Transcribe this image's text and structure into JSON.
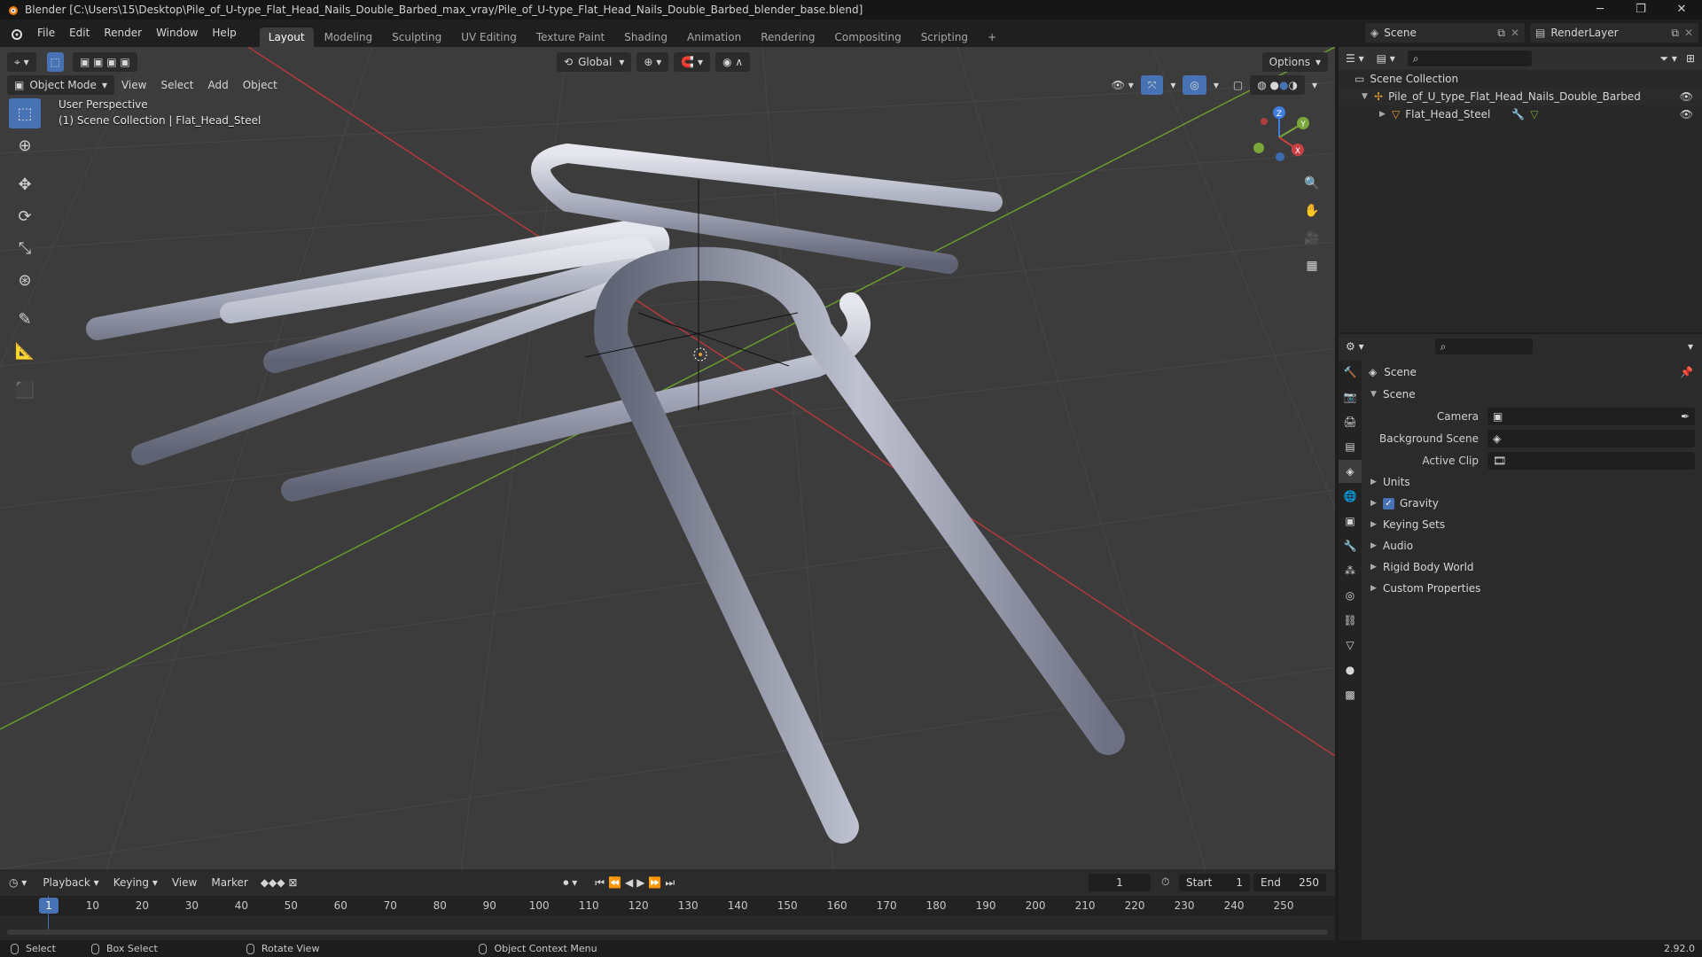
{
  "app": {
    "window_title": "Blender [C:\\Users\\15\\Desktop\\Pile_of_U-type_Flat_Head_Nails_Double_Barbed_max_vray/Pile_of_U-type_Flat_Head_Nails_Double_Barbed_blender_base.blend]",
    "version": "2.92.0"
  },
  "menu": [
    "File",
    "Edit",
    "Render",
    "Window",
    "Help"
  ],
  "workspaces": [
    {
      "label": "Layout",
      "active": true
    },
    {
      "label": "Modeling",
      "active": false
    },
    {
      "label": "Sculpting",
      "active": false
    },
    {
      "label": "UV Editing",
      "active": false
    },
    {
      "label": "Texture Paint",
      "active": false
    },
    {
      "label": "Shading",
      "active": false
    },
    {
      "label": "Animation",
      "active": false
    },
    {
      "label": "Rendering",
      "active": false
    },
    {
      "label": "Compositing",
      "active": false
    },
    {
      "label": "Scripting",
      "active": false
    }
  ],
  "scene_selector": "Scene",
  "render_layer": "RenderLayer",
  "viewport": {
    "mode": "Object Mode",
    "menus": [
      "View",
      "Select",
      "Add",
      "Object"
    ],
    "transform_orientation": "Global",
    "options_label": "Options",
    "info_line1": "User Perspective",
    "info_line2": "(1) Scene Collection | Flat_Head_Steel",
    "axis_labels": {
      "x": "X",
      "y": "Y",
      "z": "Z"
    }
  },
  "outliner": {
    "root": "Scene Collection",
    "items": [
      {
        "label": "Pile_of_U_type_Flat_Head_Nails_Double_Barbed",
        "indent": 1
      },
      {
        "label": "Flat_Head_Steel",
        "indent": 2
      }
    ]
  },
  "properties": {
    "context": "Scene",
    "panel_title": "Scene",
    "fields": [
      {
        "label": "Camera",
        "value": ""
      },
      {
        "label": "Background Scene",
        "value": ""
      },
      {
        "label": "Active Clip",
        "value": ""
      }
    ],
    "subpanels": [
      {
        "label": "Units",
        "checkbox": false
      },
      {
        "label": "Gravity",
        "checkbox": true
      },
      {
        "label": "Keying Sets",
        "checkbox": false
      },
      {
        "label": "Audio",
        "checkbox": false
      },
      {
        "label": "Rigid Body World",
        "checkbox": false
      },
      {
        "label": "Custom Properties",
        "checkbox": false
      }
    ]
  },
  "timeline": {
    "menus": [
      "Playback",
      "Keying",
      "View",
      "Marker"
    ],
    "current_frame": "1",
    "start_label": "Start",
    "start": "1",
    "end_label": "End",
    "end": "250",
    "ticks": [
      "1",
      "10",
      "20",
      "30",
      "40",
      "50",
      "60",
      "70",
      "80",
      "90",
      "100",
      "110",
      "120",
      "130",
      "140",
      "150",
      "160",
      "170",
      "180",
      "190",
      "200",
      "210",
      "220",
      "230",
      "240",
      "250"
    ]
  },
  "statusbar": {
    "items": [
      "Select",
      "Box Select",
      "Rotate View",
      "Object Context Menu"
    ]
  },
  "colors": {
    "accent": "#4772b3",
    "x_axis": "#c94040",
    "y_axis": "#7aa63a",
    "z_axis": "#3f7de0"
  }
}
